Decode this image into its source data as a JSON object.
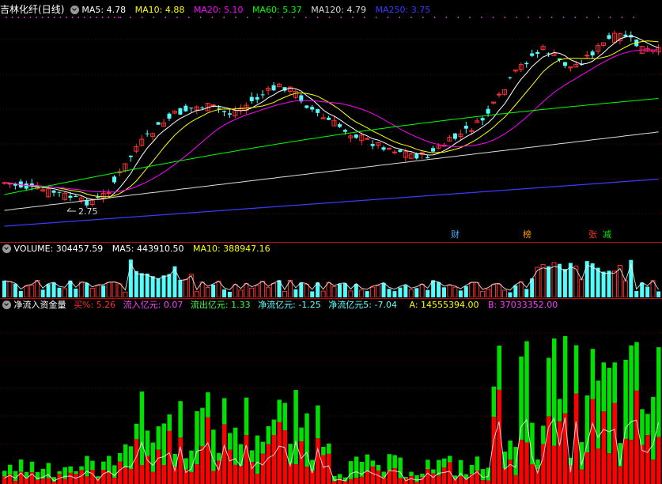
{
  "main": {
    "title": "吉林化纤",
    "period": "(日线)",
    "indicators": [
      {
        "label": "MA5: 4.78",
        "color": "#ffffff"
      },
      {
        "label": "MA10: 4.88",
        "color": "#ffff00"
      },
      {
        "label": "MA20: 5.10",
        "color": "#ff00ff"
      },
      {
        "label": "MA60: 5.37",
        "color": "#00ff00"
      },
      {
        "label": "MA120: 4.79",
        "color": "#dcdcdc"
      },
      {
        "label": "MA250: 3.75",
        "color": "#3a3aff"
      }
    ],
    "low_marker": "2.75",
    "tags": [
      {
        "text": "财",
        "color": "#4aa8ff"
      },
      {
        "text": "榜",
        "color": "#ff9900"
      },
      {
        "text": "张",
        "color": "#ff3030"
      },
      {
        "text": "减",
        "color": "#00ee00"
      }
    ]
  },
  "volume": {
    "title": "VOLUME: 304457.59",
    "ma5": "MA5: 443910.50",
    "ma10": "MA10: 388947.16"
  },
  "flow": {
    "title": "净流入资金量",
    "buy_pct_label": "买%:",
    "buy_pct_value": "5.26",
    "inflow_label": "流入亿元:",
    "inflow_value": "0.07",
    "outflow_label": "流出亿元:",
    "outflow_value": "1.33",
    "net_label": "净流亿元:",
    "net_value": "-1.25",
    "net5_label": "净流亿元5:",
    "net5_value": "-7.04",
    "a_label": "A:",
    "a_value": "14555394.00",
    "b_label": "B:",
    "b_value": "37033352.00"
  },
  "colors": {
    "up": "#ff3232",
    "down": "#54fcfc",
    "inflow": "#ff0000",
    "outflow": "#00e000",
    "grid": "#7a0000"
  }
}
